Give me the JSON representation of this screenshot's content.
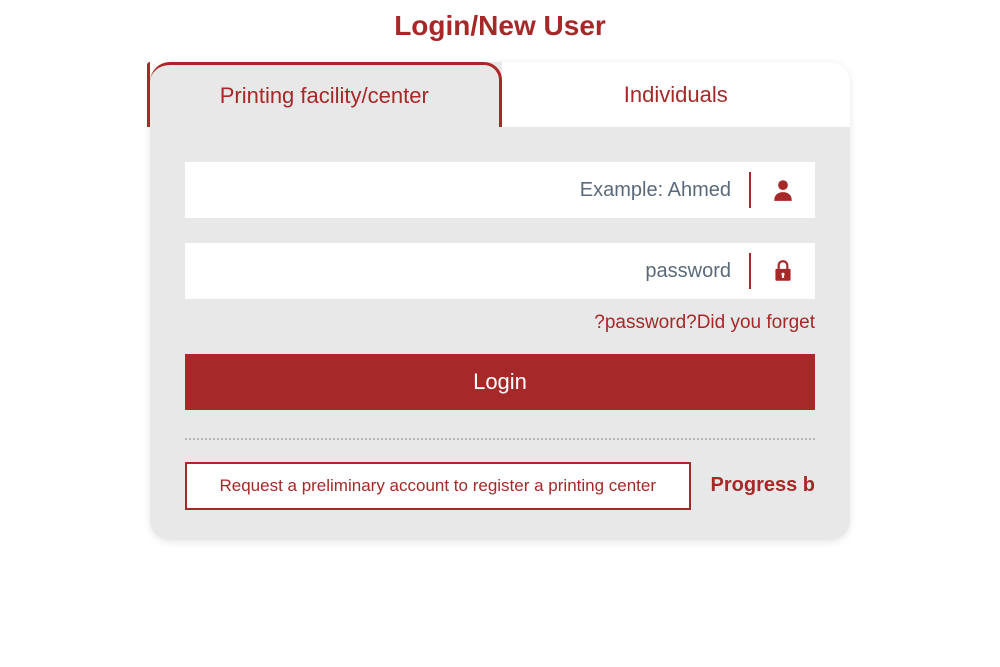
{
  "page": {
    "title": "Login/New User"
  },
  "tabs": {
    "facility": "Printing facility/center",
    "individuals": "Individuals"
  },
  "form": {
    "username_placeholder": "Example: Ahmed",
    "password_placeholder": "password",
    "forgot_text": "?password?Did you forget",
    "login_button": "Login"
  },
  "bottom": {
    "request_button": "Request a preliminary account to register a printing center",
    "progress_text": "Progress b"
  },
  "colors": {
    "primary": "#a72828",
    "panel_bg": "#e8e8e8",
    "input_bg": "#ffffff",
    "placeholder": "#5a6a7a"
  }
}
